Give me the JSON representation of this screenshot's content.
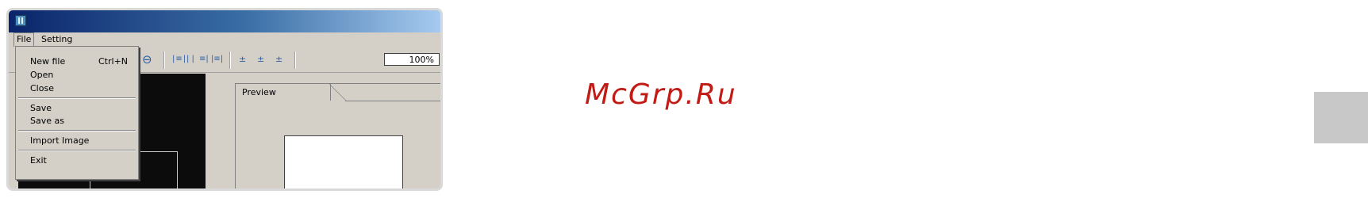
{
  "menubar": {
    "file": "File",
    "setting": "Setting"
  },
  "file_menu": {
    "items": [
      {
        "label": "New file",
        "shortcut": "Ctrl+N"
      },
      {
        "label": "Open"
      },
      {
        "label": "Close"
      },
      {
        "label": "Save"
      },
      {
        "label": "Save as"
      },
      {
        "label": "Import Image"
      },
      {
        "label": "Exit"
      }
    ]
  },
  "toolbar": {
    "zoom_value": "100%",
    "icons": [
      "zoom-out-icon",
      "align-left-icon",
      "align-center-icon",
      "align-right-icon",
      "distribute-icon",
      "align-top-icon",
      "align-middle-icon",
      "align-bottom-icon"
    ]
  },
  "preview": {
    "tab_label": "Preview"
  },
  "watermark": {
    "text": "McGrp.Ru",
    "color": "#c21a14"
  },
  "colors": {
    "titlebar_start": "#0a246a",
    "titlebar_end": "#a6caf0",
    "window_bg": "#d4d0c8"
  }
}
